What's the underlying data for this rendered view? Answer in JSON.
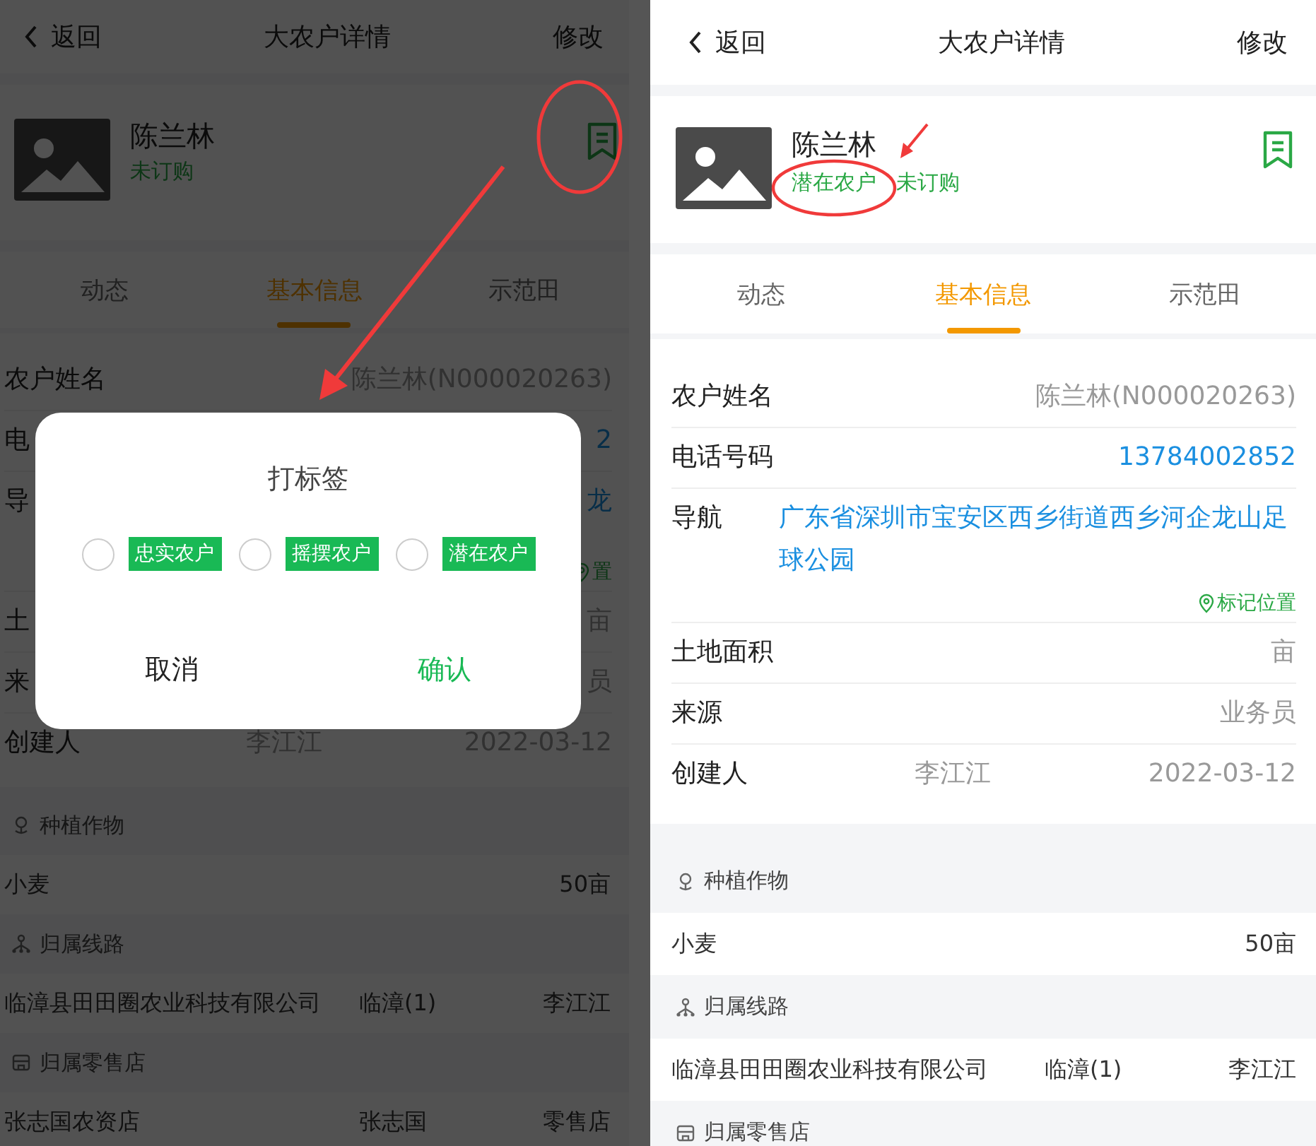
{
  "screens": [
    {
      "header": {
        "back": "返回",
        "title": "大农户详情",
        "action": "修改"
      },
      "profile": {
        "name": "陈兰林",
        "tags": [
          {
            "label": "未订购"
          }
        ]
      },
      "tabs": [
        {
          "label": "动态",
          "selected": false
        },
        {
          "label": "基本信息",
          "selected": true
        },
        {
          "label": "示范田",
          "selected": false
        }
      ],
      "info_rows": [
        {
          "kind": "text",
          "label": "农户姓名",
          "value": "陈兰林(N000020263)"
        },
        {
          "kind": "link",
          "label": "电",
          "value": "2"
        },
        {
          "kind": "address",
          "label": "导",
          "value": "龙",
          "mark": "置"
        },
        {
          "kind": "text",
          "label": "土",
          "value": "亩"
        },
        {
          "kind": "text",
          "label": "来",
          "value": "员"
        },
        {
          "kind": "triple",
          "label": "创建人",
          "value": "李江江",
          "extra": "2022-03-12"
        }
      ],
      "sections": [
        {
          "title": "种植作物",
          "rows": [
            {
              "cells": [
                "小麦",
                "50亩"
              ]
            }
          ]
        },
        {
          "title": "归属线路",
          "rows": [
            {
              "cells": [
                "临漳县田田圈农业科技有限公司",
                "临漳(1)",
                "李江江"
              ]
            }
          ]
        },
        {
          "title": "归属零售店",
          "rows": [
            {
              "cells": [
                "张志国农资店",
                "张志国",
                "零售店"
              ]
            }
          ]
        }
      ],
      "dialog": {
        "title": "打标签",
        "options": [
          {
            "label": "忠实农户",
            "selected": false
          },
          {
            "label": "摇摆农户",
            "selected": false
          },
          {
            "label": "潜在农户",
            "selected": false
          }
        ],
        "cancel": "取消",
        "confirm": "确认"
      }
    },
    {
      "header": {
        "back": "返回",
        "title": "大农户详情",
        "action": "修改"
      },
      "profile": {
        "name": "陈兰林",
        "tags": [
          {
            "label": "潜在农户"
          },
          {
            "label": "未订购"
          }
        ]
      },
      "tabs": [
        {
          "label": "动态",
          "selected": false
        },
        {
          "label": "基本信息",
          "selected": true
        },
        {
          "label": "示范田",
          "selected": false
        }
      ],
      "info_rows": [
        {
          "kind": "text",
          "label": "农户姓名",
          "value": "陈兰林(N000020263)"
        },
        {
          "kind": "link",
          "label": "电话号码",
          "value": "13784002852"
        },
        {
          "kind": "address",
          "label": "导航",
          "value": "广东省深圳市宝安区西乡街道西乡河企龙山足球公园",
          "mark": "标记位置"
        },
        {
          "kind": "text",
          "label": "土地面积",
          "value": "亩"
        },
        {
          "kind": "text",
          "label": "来源",
          "value": "业务员"
        },
        {
          "kind": "triple",
          "label": "创建人",
          "value": "李江江",
          "extra": "2022-03-12"
        }
      ],
      "sections": [
        {
          "title": "种植作物",
          "rows": [
            {
              "cells": [
                "小麦",
                "50亩"
              ]
            }
          ]
        },
        {
          "title": "归属线路",
          "rows": [
            {
              "cells": [
                "临漳县田田圈农业科技有限公司",
                "临漳(1)",
                "李江江"
              ]
            }
          ]
        },
        {
          "title": "归属零售店"
        }
      ]
    }
  ]
}
